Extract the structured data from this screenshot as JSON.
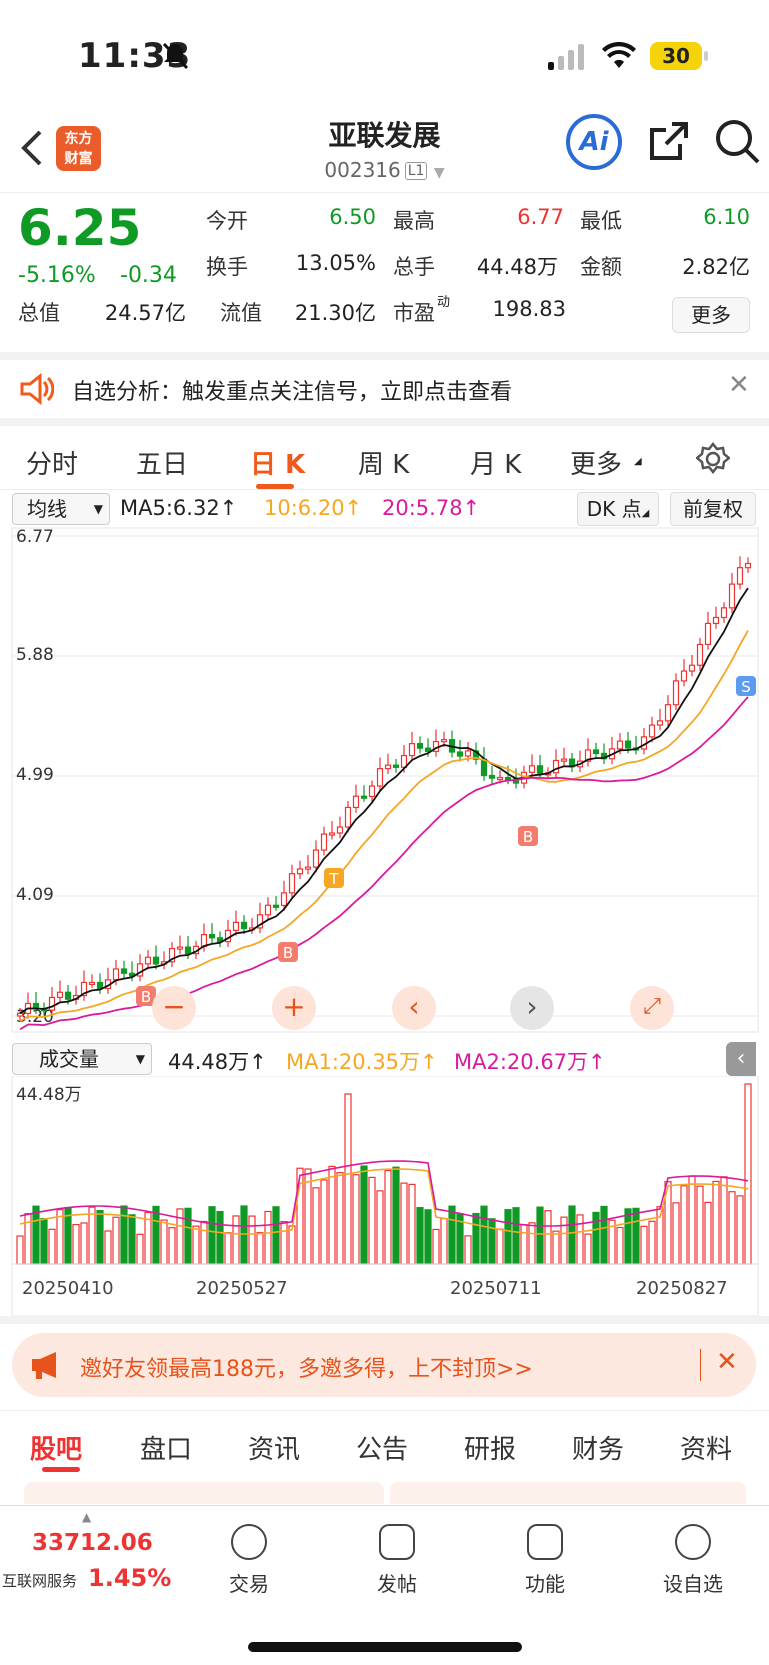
{
  "status": {
    "time": "11:33",
    "battery": "30"
  },
  "header": {
    "logo_line1": "东方",
    "logo_line2": "财富",
    "title": "亚联发展",
    "code": "002316",
    "level": "L1",
    "ai": "Ai"
  },
  "quote": {
    "price": "6.25",
    "pct": "-5.16%",
    "chg": "-0.34",
    "fields": [
      {
        "label": "今开",
        "value": "6.50",
        "color": "green"
      },
      {
        "label": "最高",
        "value": "6.77",
        "color": "red"
      },
      {
        "label": "最低",
        "value": "6.10",
        "color": "green"
      },
      {
        "label": "换手",
        "value": "13.05%",
        "color": "dark"
      },
      {
        "label": "总手",
        "value": "44.48万",
        "color": "dark"
      },
      {
        "label": "金额",
        "value": "2.82亿",
        "color": "dark"
      },
      {
        "label": "总值",
        "value": "24.57亿",
        "color": "dark"
      },
      {
        "label": "流值",
        "value": "21.30亿",
        "color": "dark"
      },
      {
        "label": "市盈",
        "value": "198.83",
        "color": "dark",
        "sup": "动"
      }
    ],
    "more": "更多"
  },
  "notice": {
    "text": "自选分析：触发重点关注信号，立即点击查看"
  },
  "tabs": [
    {
      "label": "分时"
    },
    {
      "label": "五日"
    },
    {
      "label": "日 K",
      "active": true
    },
    {
      "label": "周 K"
    },
    {
      "label": "月 K"
    },
    {
      "label": "更多"
    }
  ],
  "indicators": {
    "selector": "均线",
    "ma5": "MA5:6.32↑",
    "ma10": "10:6.20↑",
    "ma20": "20:5.78↑",
    "dk": "DK 点",
    "fuquan": "前复权",
    "ma10_color": "#f5a623",
    "ma20_color": "#d81b9e"
  },
  "price_axis": [
    "6.77",
    "5.88",
    "4.99",
    "4.09",
    "3.20"
  ],
  "vol_bar": {
    "selector": "成交量",
    "vol": "44.48万↑",
    "ma1": "MA1:20.35万↑",
    "ma2": "MA2:20.67万↑",
    "axis_top": "44.48万"
  },
  "dates": [
    "20250410",
    "20250527",
    "20250711",
    "20250827"
  ],
  "markers": [
    "B",
    "B",
    "T",
    "B",
    "S"
  ],
  "invite": {
    "text": "邀好友领最高188元，多邀多得，上不封顶>>"
  },
  "bottom_tabs": [
    {
      "label": "股吧",
      "active": true
    },
    {
      "label": "盘口"
    },
    {
      "label": "资讯"
    },
    {
      "label": "公告"
    },
    {
      "label": "研报"
    },
    {
      "label": "财务"
    },
    {
      "label": "资料"
    }
  ],
  "bottom_nav": {
    "index_value": "33712.06",
    "index_name": "互联网服务",
    "index_pct": "1.45%",
    "items": [
      "交易",
      "发帖",
      "功能",
      "设自选"
    ]
  },
  "colors": {
    "up": "#e33",
    "down": "#0f9a26",
    "accent": "#f05a1a"
  }
}
